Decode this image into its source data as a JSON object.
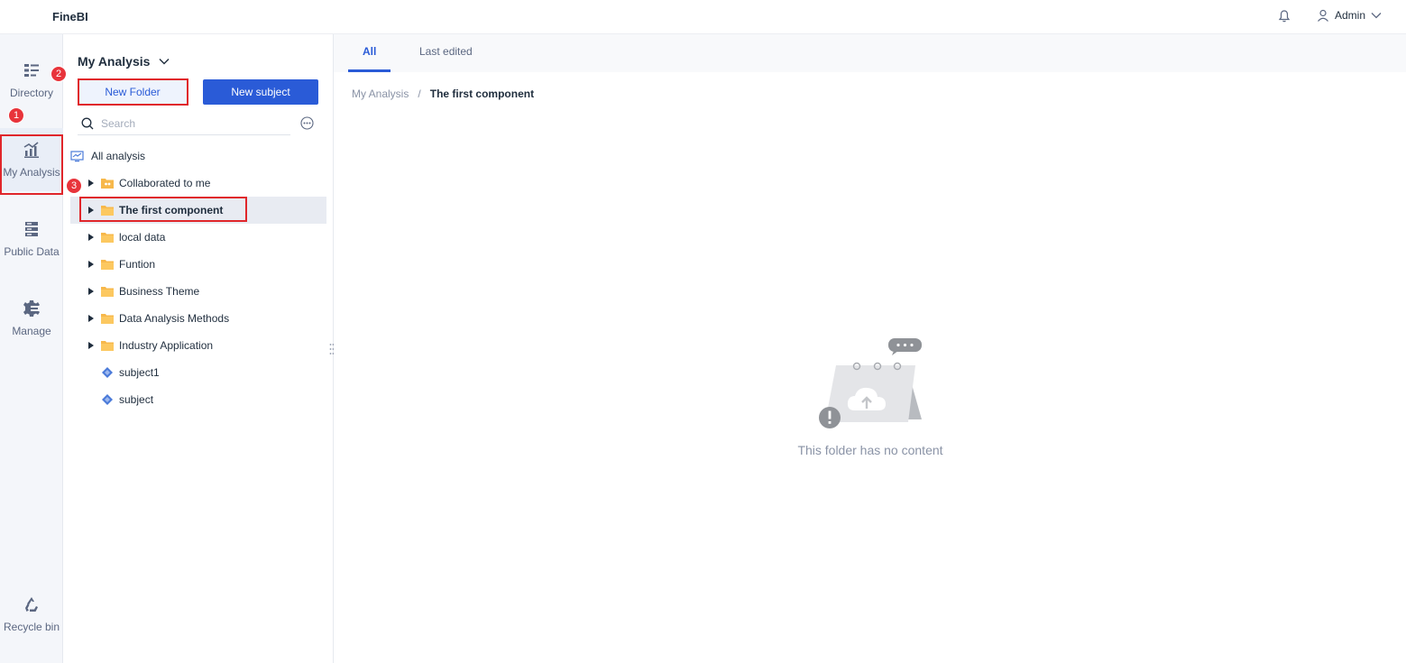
{
  "app": {
    "title": "FineBI"
  },
  "header": {
    "user_name": "Admin"
  },
  "sidebar": {
    "items": [
      {
        "label": "Directory"
      },
      {
        "label": "My Analysis"
      },
      {
        "label": "Public Data"
      },
      {
        "label": "Manage"
      },
      {
        "label": "Recycle bin"
      }
    ]
  },
  "annotations": {
    "badge1": "1",
    "badge2": "2",
    "badge3": "3"
  },
  "panel": {
    "title": "My Analysis",
    "new_folder_label": "New Folder",
    "new_subject_label": "New subject",
    "search_placeholder": "Search",
    "tree": [
      {
        "label": "All analysis",
        "type": "root"
      },
      {
        "label": "Collaborated to me",
        "type": "folder"
      },
      {
        "label": "The first component",
        "type": "folder",
        "selected": true
      },
      {
        "label": "local data",
        "type": "folder"
      },
      {
        "label": "Funtion",
        "type": "folder"
      },
      {
        "label": "Business Theme",
        "type": "folder"
      },
      {
        "label": "Data Analysis Methods",
        "type": "folder"
      },
      {
        "label": "Industry Application",
        "type": "folder"
      },
      {
        "label": "subject1",
        "type": "subject"
      },
      {
        "label": "subject",
        "type": "subject"
      }
    ]
  },
  "content": {
    "tabs": [
      {
        "label": "All",
        "active": true
      },
      {
        "label": "Last edited"
      }
    ],
    "breadcrumb": {
      "root": "My Analysis",
      "separator": "/",
      "current": "The first component"
    },
    "empty_text": "This folder has no content"
  },
  "colors": {
    "accent": "#2a5bd7",
    "highlight": "#e0262b",
    "folder": "#f7b84b"
  }
}
